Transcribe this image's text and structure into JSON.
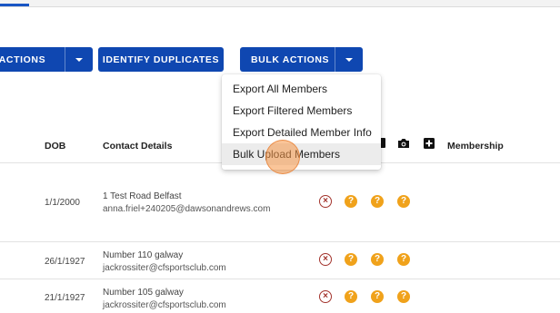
{
  "toolbar": {
    "more_actions_label": "E ACTIONS",
    "identify_duplicates_label": "IDENTIFY DUPLICATES",
    "bulk_actions_label": "BULK ACTIONS"
  },
  "bulk_menu": {
    "items": [
      {
        "label": "Export All Members"
      },
      {
        "label": "Export Filtered Members"
      },
      {
        "label": "Export Detailed Member Info"
      },
      {
        "label": "Bulk Upload Members"
      }
    ]
  },
  "table": {
    "columns": {
      "dob": "DOB",
      "contact": "Contact Details",
      "membership": "Membership"
    },
    "header_icons": [
      "flag-icon",
      "camera-icon",
      "add-box-icon"
    ],
    "rows": [
      {
        "dob": "1/1/2000",
        "address": "1 Test Road Belfast",
        "email": "anna.friel+240205@dawsonandrews.com",
        "status_icons": [
          "cancel-icon",
          "help-icon",
          "help-icon",
          "help-icon"
        ]
      },
      {
        "dob": "26/1/1927",
        "address": "Number 110 galway",
        "email": "jackrossiter@cfsportsclub.com",
        "status_icons": [
          "cancel-icon",
          "help-icon",
          "help-icon",
          "help-icon"
        ]
      },
      {
        "dob": "21/1/1927",
        "address": "Number 105 galway",
        "email": "jackrossiter@cfsportsclub.com",
        "status_icons": [
          "cancel-icon",
          "help-icon",
          "help-icon",
          "help-icon"
        ]
      }
    ]
  },
  "colors": {
    "primary": "#0f47b1",
    "cancel": "#a3332c",
    "unknown": "#f0a21b",
    "cursor_highlight": "#f5964a"
  }
}
